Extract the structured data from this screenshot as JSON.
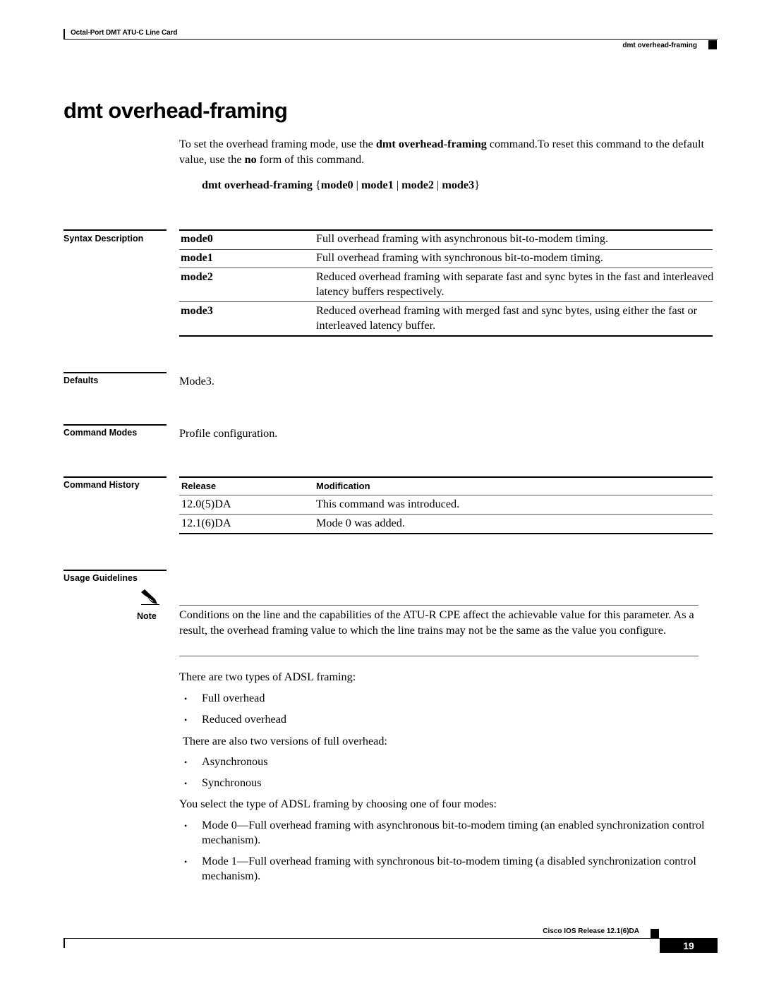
{
  "header": {
    "book_title": "Octal-Port DMT ATU-C Line Card",
    "section_title": "dmt overhead-framing"
  },
  "page_title": "dmt overhead-framing",
  "intro": {
    "part1": "To set the overhead framing mode, use the ",
    "cmd_bold": "dmt overhead-framing",
    "part2": " command.To reset this command to the default value, use the ",
    "no_bold": "no",
    "part3": " form of this command."
  },
  "syntax": {
    "command": "dmt overhead-framing",
    "open_brace": "{",
    "options": [
      "mode0",
      "mode1",
      "mode2",
      "mode3"
    ],
    "separator": " | ",
    "close_brace": "}"
  },
  "syntax_description": {
    "label": "Syntax Description",
    "rows": [
      {
        "keyword": "mode0",
        "description": "Full overhead framing with asynchronous bit-to-modem timing."
      },
      {
        "keyword": "mode1",
        "description": "Full overhead framing with synchronous bit-to-modem timing."
      },
      {
        "keyword": "mode2",
        "description": "Reduced overhead framing with separate fast and sync bytes in the fast and interleaved latency buffers respectively."
      },
      {
        "keyword": "mode3",
        "description": "Reduced overhead framing with merged fast and sync bytes, using either the fast or interleaved latency buffer."
      }
    ]
  },
  "defaults": {
    "label": "Defaults",
    "value": "Mode3."
  },
  "command_modes": {
    "label": "Command Modes",
    "value": "Profile configuration."
  },
  "command_history": {
    "label": "Command History",
    "headers": [
      "Release",
      "Modification"
    ],
    "rows": [
      {
        "release": "12.0(5)DA",
        "modification": "This command was introduced."
      },
      {
        "release": "12.1(6)DA",
        "modification": "Mode 0 was added."
      }
    ]
  },
  "usage_guidelines": {
    "label": "Usage Guidelines",
    "note_label": "Note",
    "note_icon": "pencil-note-icon",
    "note_text": "Conditions on the line and the capabilities of the ATU-R CPE affect the achievable value for this parameter. As a result, the overhead framing value to which the line trains may not be the same as the value you configure.",
    "para1": "There are two types of ADSL framing:",
    "list1": [
      "Full overhead",
      "Reduced overhead"
    ],
    "para2": "There are also two versions of full overhead:",
    "list2": [
      "Asynchronous",
      "Synchronous"
    ],
    "para3": "You select the type of ADSL framing by choosing one of four modes:",
    "list3": [
      "Mode 0—Full overhead framing with asynchronous bit-to-modem timing (an enabled synchronization control mechanism).",
      "Mode 1—Full overhead framing with synchronous bit-to-modem timing (a disabled synchronization control mechanism)."
    ],
    "bullet_glyph": "•"
  },
  "footer": {
    "release": "Cisco IOS Release 12.1(6)DA",
    "page_number": "19"
  }
}
